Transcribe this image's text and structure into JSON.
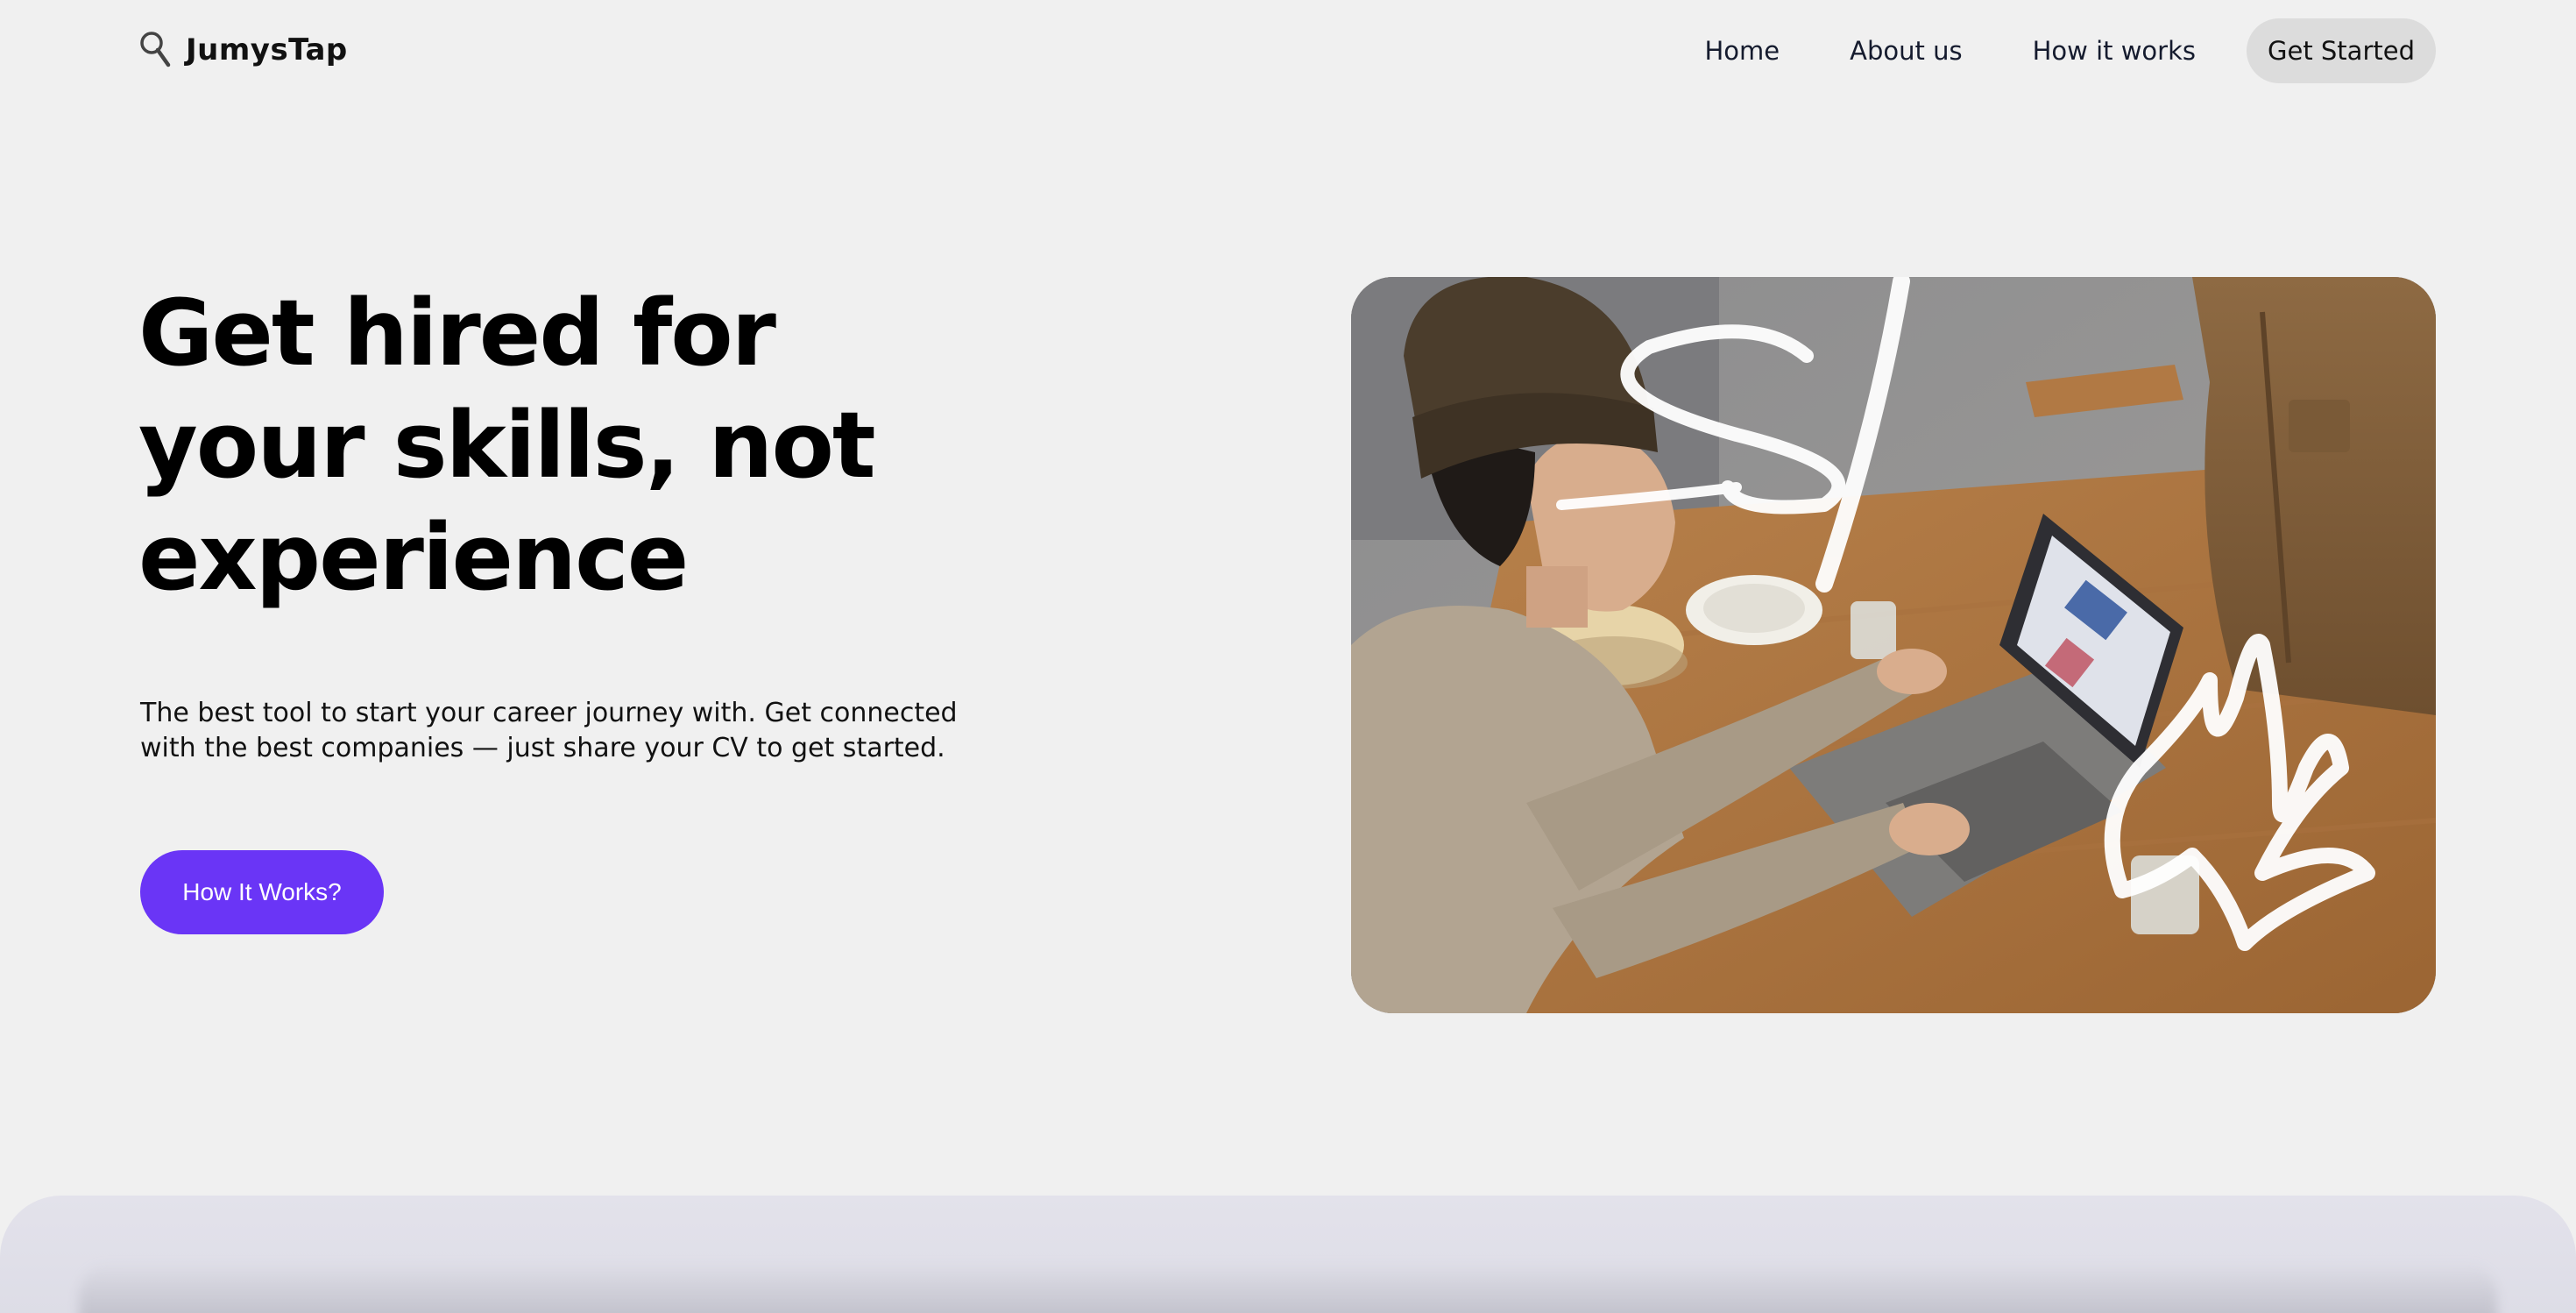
{
  "brand": {
    "name": "JumysTap",
    "icon": "magnifier-icon"
  },
  "nav": {
    "items": [
      {
        "label": "Home"
      },
      {
        "label": "About us"
      },
      {
        "label": "How it works"
      }
    ],
    "cta_label": "Get Started"
  },
  "hero": {
    "title_lines": [
      "Get hired for",
      "your skills, not",
      "experience"
    ],
    "description_lines": [
      "The best tool to start your career journey with. Get connected",
      "with the best companies — just share your CV to get started."
    ],
    "button_label": "How It Works?",
    "image": "photo of a woman in a beanie using a laptop at a wooden table, with white brush-stroke doodles"
  },
  "colors": {
    "accent": "#6a35f6",
    "background": "#f0f0f0",
    "nav_cta_bg": "#dcdcdc",
    "panel": "#e3e2eb"
  }
}
